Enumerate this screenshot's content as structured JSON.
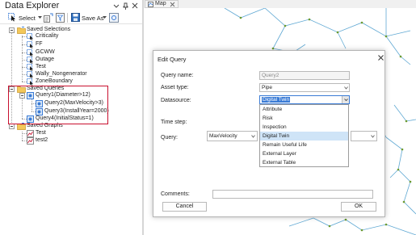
{
  "explorer": {
    "title": "Data Explorer",
    "toolbar": {
      "select_label": "Select",
      "save_as_label": "Save As"
    },
    "tree": {
      "saved_selections": {
        "label": "Saved Selections",
        "items": [
          "Criticality",
          "FF",
          "GCWW",
          "Outage",
          "Test",
          "Wally_Nongenerator",
          "ZoneBoundary"
        ]
      },
      "saved_queries": {
        "label": "Saved Queries",
        "query1": "Query1(Diameter>12)",
        "query2": "Query2(MaxVelocity>3)",
        "query3": "Query3(InstallYear=2000)",
        "query4": "Query4(InitialStatus=1)"
      },
      "saved_graphs": {
        "label": "Saved Graphs",
        "items": [
          "Test",
          "test2"
        ]
      }
    }
  },
  "map_tab": {
    "label": "Map"
  },
  "dialog": {
    "title": "Edit Query",
    "query_name_label": "Query name:",
    "query_name_value": "Query2",
    "asset_type_label": "Asset type:",
    "asset_type_value": "Pipe",
    "datasource_label": "Datasource:",
    "datasource_value": "Digital Twin",
    "datasource_options": [
      "Attribute",
      "Risk",
      "Inspection",
      "Digital Twin",
      "Remain Useful Life",
      "External Layer",
      "External Table"
    ],
    "time_step_label": "Time step:",
    "query_label": "Query:",
    "query_field_value": "MaxVelocity",
    "comments_label": "Comments:",
    "cancel_label": "Cancel",
    "ok_label": "OK"
  },
  "colors": {
    "highlight": "#c8102e",
    "folder": "#e8b53a",
    "query_icon": "#3a7bd5",
    "map_lines": "#5fa8d3",
    "map_nodes": "#6c9a2f"
  }
}
